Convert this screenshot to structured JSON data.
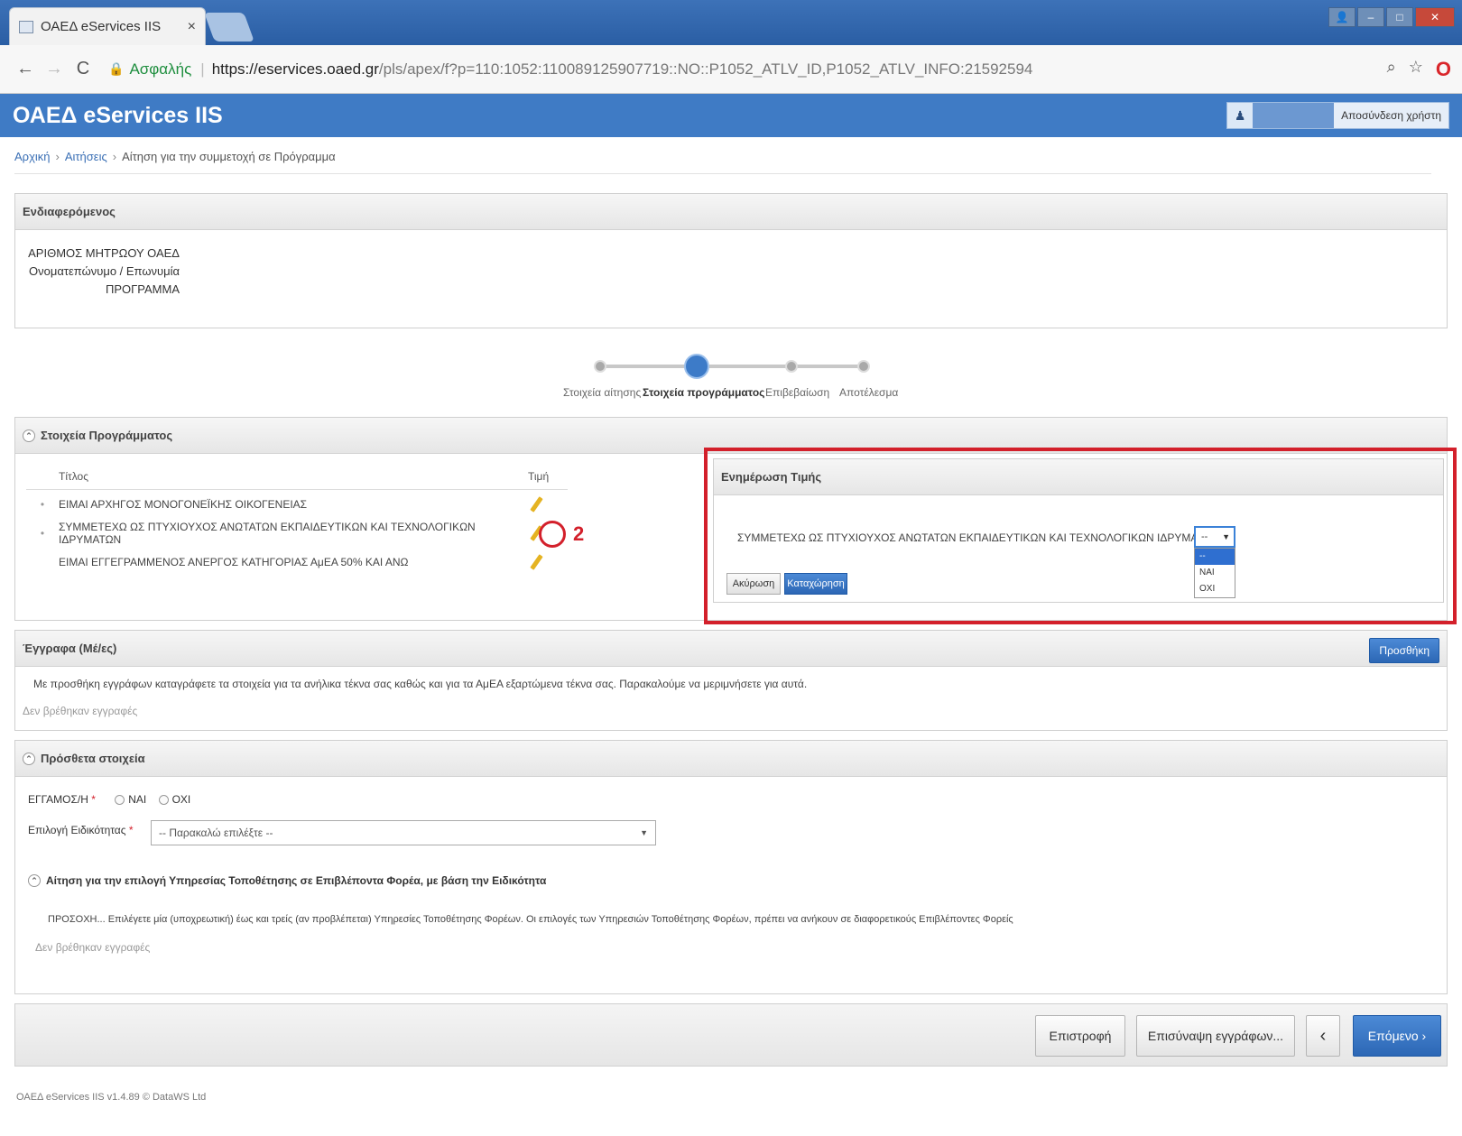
{
  "browser": {
    "tab_title": "ΟΑΕΔ eServices IIS",
    "tab_close": "×",
    "secure_label": "Ασφαλής",
    "url_host": "https://eservices.oaed.gr",
    "url_path": "/pls/apex/f?p=110:1052:110089125907719::NO::P1052_ATLV_ID,P1052_ATLV_INFO:21592594"
  },
  "header": {
    "app_title": "ΟΑΕΔ eServices IIS",
    "logout_label": "Αποσύνδεση χρήστη"
  },
  "breadcrumb": {
    "home": "Αρχική",
    "requests": "Αιτήσεις",
    "current": "Αίτηση για την συμμετοχή σε Πρόγραμμα"
  },
  "insured_panel": {
    "title": "Ενδιαφερόμενος",
    "lines": [
      "ΑΡΙΘΜΟΣ ΜΗΤΡΩΟΥ ΟΑΕΔ",
      "Ονοματεπώνυμο / Επωνυμία",
      "ΠΡΟΓΡΑΜΜΑ"
    ]
  },
  "wizard": {
    "steps": [
      "Στοιχεία αίτησης",
      "Στοιχεία προγράμματος",
      "Επιβεβαίωση",
      "Αποτέλεσμα"
    ],
    "active_step": 2
  },
  "program_panel": {
    "title": "Στοιχεία Προγράμματος",
    "col_title": "Τίτλος",
    "col_value": "Τιμή",
    "rows": [
      "ΕΙΜΑΙ ΑΡΧΗΓΟΣ ΜΟΝΟΓΟΝΕΪΚΗΣ ΟΙΚΟΓΕΝΕΙΑΣ",
      "ΣΥΜΜΕΤΕΧΩ ΩΣ ΠΤΥΧΙΟΥΧΟΣ ΑΝΩΤΑΤΩΝ ΕΚΠΑΙΔΕΥΤΙΚΩΝ ΚΑΙ ΤΕΧΝΟΛΟΓΙΚΩΝ ΙΔΡΥΜΑΤΩΝ",
      "ΕΙΜΑΙ ΕΓΓΕΓΡΑΜΜΕΝΟΣ ΑΝΕΡΓΟΣ ΚΑΤΗΓΟΡΙΑΣ ΑμΕΑ 50% ΚΑΙ ΑΝΩ"
    ],
    "annotation_number": "2"
  },
  "edit_value": {
    "title": "Ενημέρωση Τιμής",
    "field_label": "ΣΥΜΜΕΤΕΧΩ ΩΣ ΠΤΥΧΙΟΥΧΟΣ ΑΝΩΤΑΤΩΝ ΕΚΠΑΙΔΕΥΤΙΚΩΝ ΚΑΙ ΤΕΧΝΟΛΟΓΙΚΩΝ ΙΔΡΥΜΑΤΩΝ",
    "selected": "--",
    "options": [
      "--",
      "ΝΑΙ",
      "ΟΧΙ"
    ],
    "cancel_label": "Ακύρωση",
    "save_label": "Καταχώρηση"
  },
  "documents_panel": {
    "title": "Έγγραφα (Μέ/ες)",
    "add_label": "Προσθήκη",
    "description": "Με προσθήκη εγγράφων καταγράφετε τα στοιχεία για τα ανήλικα τέκνα σας καθώς και για τα ΑμΕΑ εξαρτώμενα τέκνα σας. Παρακαλούμε να μεριμνήσετε για αυτά.",
    "empty": "Δεν βρέθηκαν εγγραφές"
  },
  "extra_panel": {
    "title": "Πρόσθετα στοιχεία",
    "vocational_label": "ΕΓΓΑΜΟΣ/Η",
    "yes": "ΝΑΙ",
    "no": "ΟΧΙ",
    "specialty_label": "Επιλογή Ειδικότητας",
    "specialty_placeholder": "-- Παρακαλώ επιλέξτε --",
    "sub_title": "Αίτηση για την επιλογή Υπηρεσίας Τοποθέτησης σε Επιβλέποντα Φορέα, με βάση την Ειδικότητα",
    "notice": "ΠΡΟΣΟΧΗ... Επιλέγετε μία (υποχρεωτική) έως και τρείς (αν προβλέπεται) Υπηρεσίες Τοποθέτησης Φορέων. Οι επιλογές των Υπηρεσιών Τοποθέτησης Φορέων, πρέπει να ανήκουν σε διαφορετικούς Επιβλέποντες Φορείς",
    "empty": "Δεν βρέθηκαν εγγραφές"
  },
  "toolbar": {
    "back_label": "Επιστροφή",
    "upload_label": "Επισύναψη εγγράφων...",
    "prev_label": "‹",
    "next_label": "Επόμενο ›"
  },
  "footer": {
    "text": "ΟΑΕΔ eServices IIS v1.4.89 © DataWS Ltd"
  },
  "colors": {
    "brand_blue": "#3f7bc5",
    "highlight_red": "#d3202b"
  },
  "icons": [
    "back-arrow-icon",
    "forward-arrow-icon",
    "reload-icon",
    "lock-icon",
    "zoom-icon",
    "star-icon",
    "opera-icon",
    "user-icon",
    "pencil-icon",
    "collapse-icon"
  ]
}
